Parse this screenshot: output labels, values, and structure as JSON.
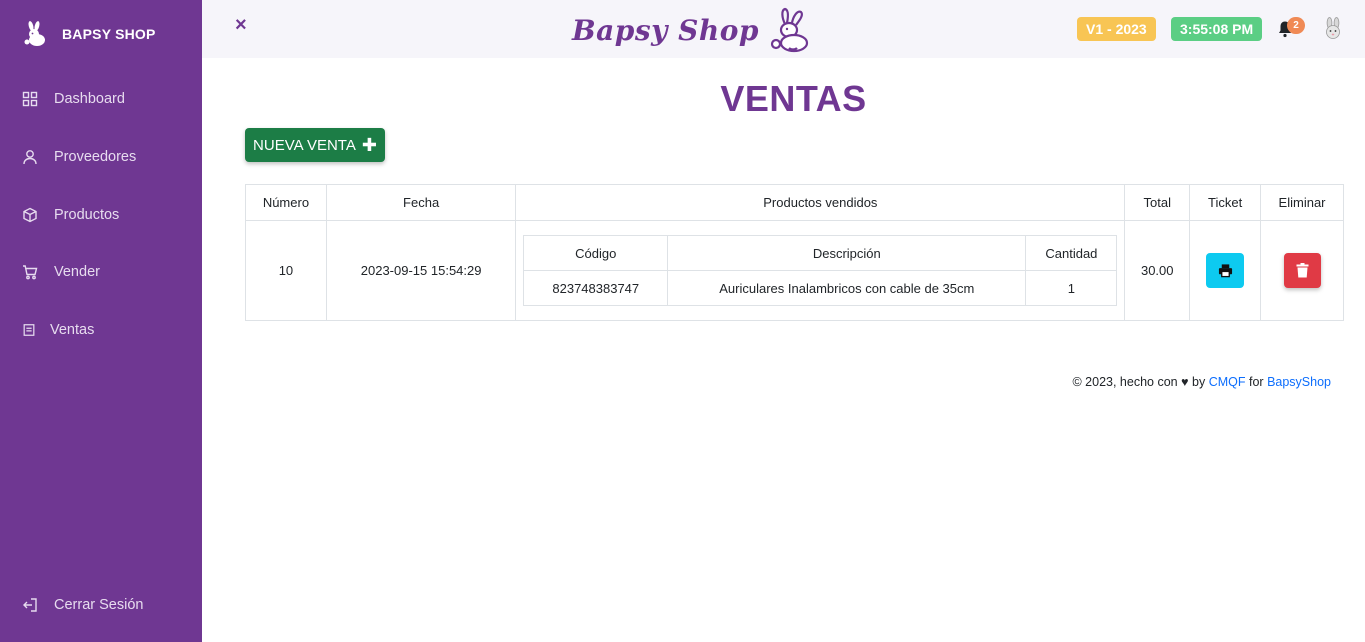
{
  "sidebar": {
    "brand": "BAPSY SHOP",
    "items": [
      {
        "label": "Dashboard",
        "icon": "grid-icon"
      },
      {
        "label": "Proveedores",
        "icon": "user-icon"
      },
      {
        "label": "Productos",
        "icon": "box-icon"
      },
      {
        "label": "Vender",
        "icon": "cart-icon"
      },
      {
        "label": "Ventas",
        "icon": "receipt-icon"
      }
    ],
    "logout": "Cerrar Sesión"
  },
  "header": {
    "close": "×",
    "logo_text": "Bapsy Shop",
    "version": "V1 - 2023",
    "time": "3:55:08 PM",
    "notifications": "2"
  },
  "main": {
    "title": "VENTAS",
    "new_sale_label": "NUEVA VENTA",
    "table": {
      "headers": [
        "Número",
        "Fecha",
        "Productos vendidos",
        "Total",
        "Ticket",
        "Eliminar"
      ],
      "inner_headers": [
        "Código",
        "Descripción",
        "Cantidad"
      ],
      "rows": [
        {
          "numero": "10",
          "fecha": "2023-09-15 15:54:29",
          "productos": [
            {
              "codigo": "823748383747",
              "descripcion": "Auriculares Inalambricos con cable de 35cm",
              "cantidad": "1"
            }
          ],
          "total": "30.00"
        }
      ]
    }
  },
  "footer": {
    "prefix": "© 2023, hecho con",
    "by": "by",
    "author": "CMQF",
    "for": "for",
    "site": "BapsyShop"
  },
  "colors": {
    "sidebar": "#6f3792",
    "version_badge": "#f8c554",
    "time_badge": "#5bce84",
    "new_sale": "#1c7d46",
    "ticket": "#0dcaf0",
    "delete": "#e03a45"
  }
}
